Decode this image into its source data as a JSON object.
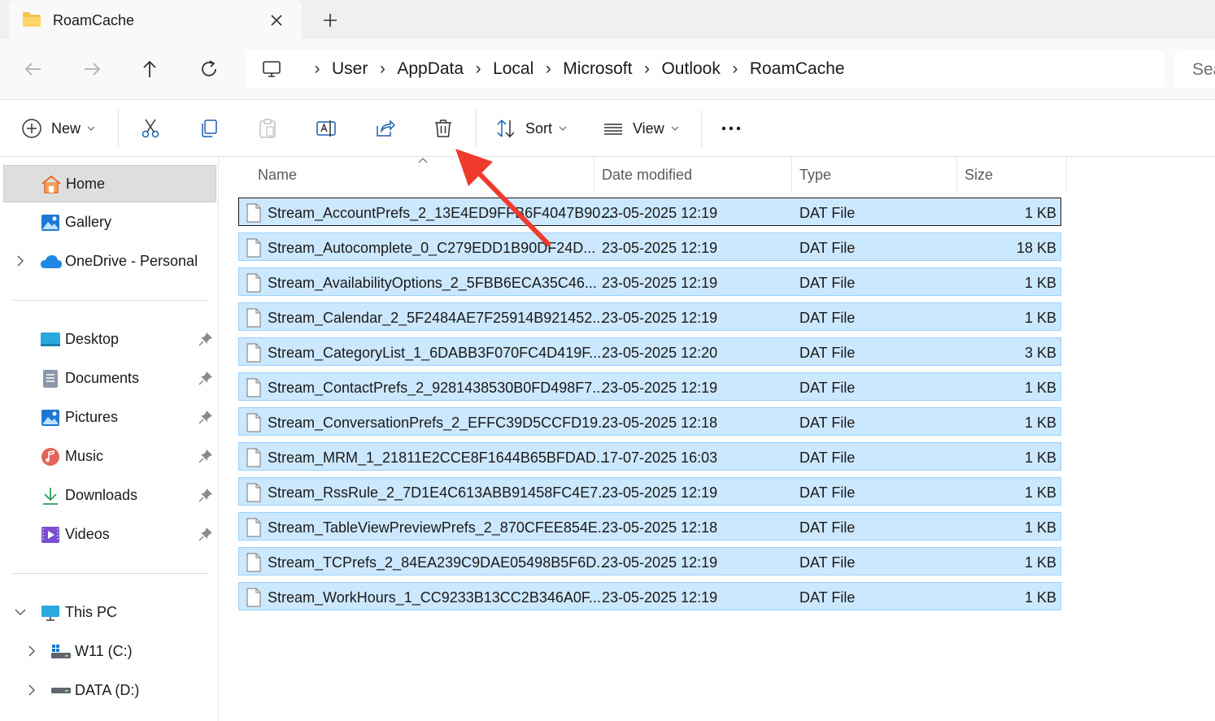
{
  "tab": {
    "title": "RoamCache",
    "close_icon": "close-icon",
    "new_tab_icon": "plus-icon"
  },
  "address": {
    "crumbs": [
      "User",
      "AppData",
      "Local",
      "Microsoft",
      "Outlook",
      "RoamCache"
    ],
    "search_placeholder": "Sea"
  },
  "toolbar": {
    "new_label": "New",
    "sort_label": "Sort",
    "view_label": "View"
  },
  "sidebar": {
    "home": "Home",
    "gallery": "Gallery",
    "onedrive": "OneDrive - Personal",
    "quick": [
      {
        "label": "Desktop",
        "icon": "desktop-icon"
      },
      {
        "label": "Documents",
        "icon": "documents-icon"
      },
      {
        "label": "Pictures",
        "icon": "pictures-icon"
      },
      {
        "label": "Music",
        "icon": "music-icon"
      },
      {
        "label": "Downloads",
        "icon": "downloads-icon"
      },
      {
        "label": "Videos",
        "icon": "videos-icon"
      }
    ],
    "this_pc": "This PC",
    "drives": [
      "W11 (C:)",
      "DATA (D:)"
    ]
  },
  "columns": {
    "name": "Name",
    "date": "Date modified",
    "type": "Type",
    "size": "Size"
  },
  "files": [
    {
      "name": "Stream_AccountPrefs_2_13E4ED9FFB6F4047B90...",
      "date": "23-05-2025 12:19",
      "type": "DAT File",
      "size": "1 KB"
    },
    {
      "name": "Stream_Autocomplete_0_C279EDD1B90DF24D...",
      "date": "23-05-2025 12:19",
      "type": "DAT File",
      "size": "18 KB"
    },
    {
      "name": "Stream_AvailabilityOptions_2_5FBB6ECA35C46...",
      "date": "23-05-2025 12:19",
      "type": "DAT File",
      "size": "1 KB"
    },
    {
      "name": "Stream_Calendar_2_5F2484AE7F25914B921452...",
      "date": "23-05-2025 12:19",
      "type": "DAT File",
      "size": "1 KB"
    },
    {
      "name": "Stream_CategoryList_1_6DABB3F070FC4D419F...",
      "date": "23-05-2025 12:20",
      "type": "DAT File",
      "size": "3 KB"
    },
    {
      "name": "Stream_ContactPrefs_2_9281438530B0FD498F7...",
      "date": "23-05-2025 12:19",
      "type": "DAT File",
      "size": "1 KB"
    },
    {
      "name": "Stream_ConversationPrefs_2_EFFC39D5CCFD19...",
      "date": "23-05-2025 12:18",
      "type": "DAT File",
      "size": "1 KB"
    },
    {
      "name": "Stream_MRM_1_21811E2CCE8F1644B65BFDAD...",
      "date": "17-07-2025 16:03",
      "type": "DAT File",
      "size": "1 KB"
    },
    {
      "name": "Stream_RssRule_2_7D1E4C613ABB91458FC4E7...",
      "date": "23-05-2025 12:19",
      "type": "DAT File",
      "size": "1 KB"
    },
    {
      "name": "Stream_TableViewPreviewPrefs_2_870CFEE854E...",
      "date": "23-05-2025 12:18",
      "type": "DAT File",
      "size": "1 KB"
    },
    {
      "name": "Stream_TCPrefs_2_84EA239C9DAE05498B5F6D...",
      "date": "23-05-2025 12:19",
      "type": "DAT File",
      "size": "1 KB"
    },
    {
      "name": "Stream_WorkHours_1_CC9233B13CC2B346A0F...",
      "date": "23-05-2025 12:19",
      "type": "DAT File",
      "size": "1 KB"
    }
  ],
  "colors": {
    "selection_fill": "#cce8ff",
    "selection_border": "#99d1ff",
    "annotation_arrow": "#ef3b2c"
  }
}
